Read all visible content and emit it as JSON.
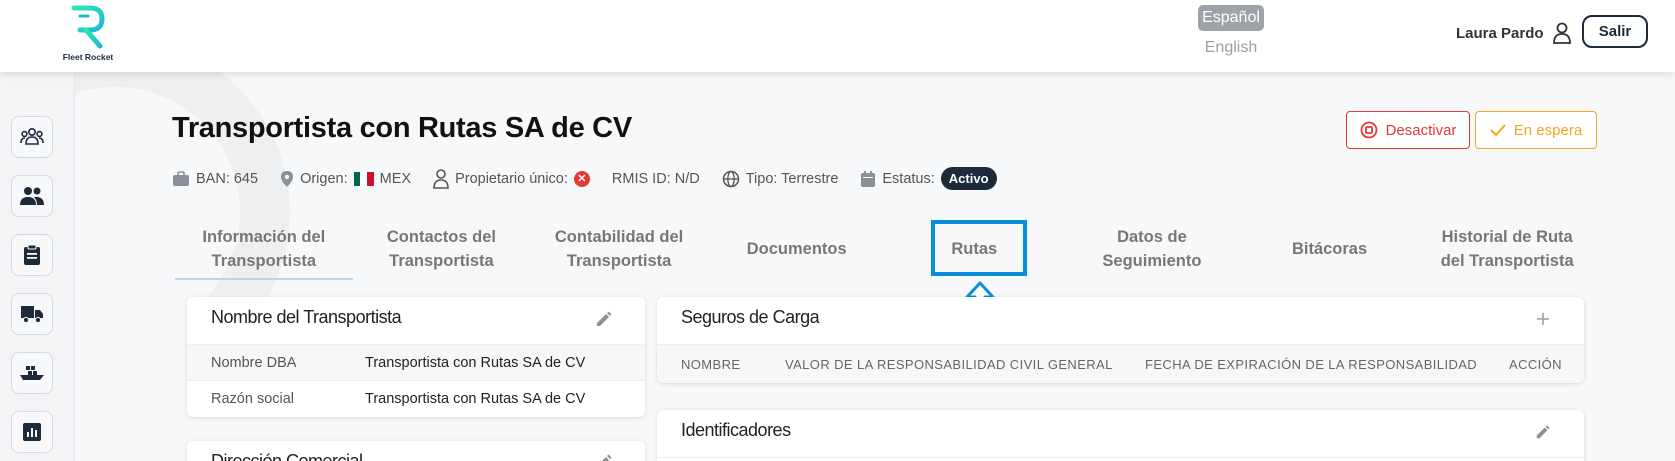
{
  "header": {
    "logo_text": "Fleet Rocket",
    "lang_active": "Español",
    "lang_other": "English",
    "user_name": "Laura Pardo",
    "logout_label": "Salir"
  },
  "sidebar": {
    "items": [
      "users-group-icon",
      "people-icon",
      "clipboard-icon",
      "truck-icon",
      "ship-icon",
      "chart-icon"
    ]
  },
  "page": {
    "title": "Transportista con Rutas SA de CV",
    "meta": {
      "ban": "BAN: 645",
      "origin_label": "Origen:",
      "origin_value": "MEX",
      "owner_label": "Propietario único:",
      "rmis": "RMIS ID: N/D",
      "type": "Tipo: Terrestre",
      "status_label": "Estatus:",
      "status_value": "Activo"
    },
    "actions": {
      "deactivate": "Desactivar",
      "on_hold": "En espera"
    }
  },
  "tabs": [
    {
      "line1": "Información del",
      "line2": "Transportista"
    },
    {
      "line1": "Contactos del",
      "line2": "Transportista"
    },
    {
      "line1": "Contabilidad del",
      "line2": "Transportista"
    },
    {
      "line1": "Documentos",
      "line2": ""
    },
    {
      "line1": "Rutas",
      "line2": ""
    },
    {
      "line1": "Datos de",
      "line2": "Seguimiento"
    },
    {
      "line1": "Bitácoras",
      "line2": ""
    },
    {
      "line1": "Historial de Ruta",
      "line2": "del Transportista"
    }
  ],
  "carrier_name_card": {
    "title": "Nombre del Transportista",
    "rows": [
      {
        "label": "Nombre DBA",
        "value": "Transportista con Rutas SA de CV"
      },
      {
        "label": "Razón social",
        "value": "Transportista con Rutas SA de CV"
      }
    ]
  },
  "address_card": {
    "title": "Dirección Comercial"
  },
  "cargo_insurance_card": {
    "title": "Seguros de Carga",
    "columns": [
      "NOMBRE",
      "VALOR DE LA RESPONSABILIDAD CIVIL GENERAL",
      "FECHA DE EXPIRACIÓN DE LA RESPONSABILIDAD",
      "ACCIÓN"
    ]
  },
  "identifiers_card": {
    "title": "Identificadores"
  },
  "colors": {
    "navy": "#1d2a3a",
    "danger": "#e53935",
    "warning": "#f5a623",
    "highlight": "#0a8fe0",
    "brand_teal": "#2ee6b6"
  }
}
